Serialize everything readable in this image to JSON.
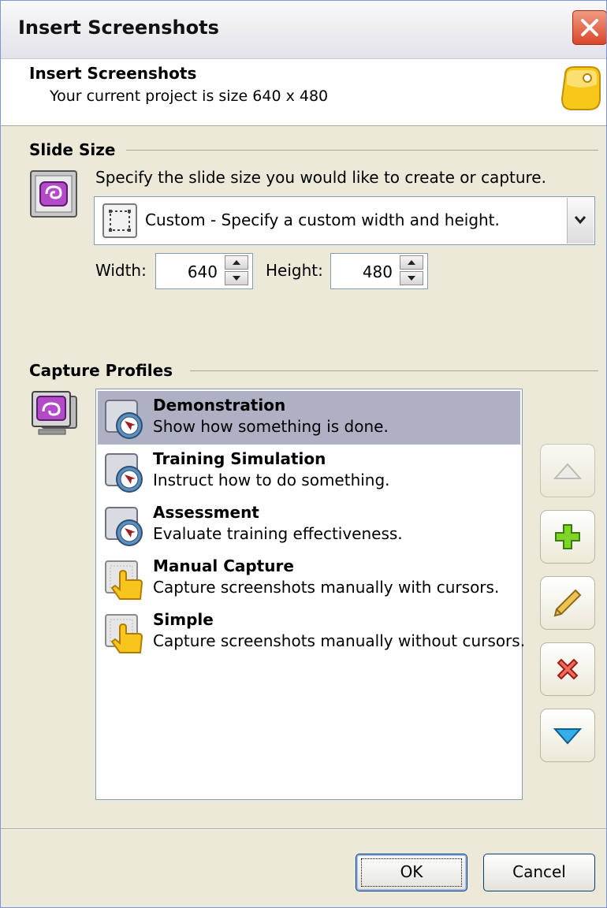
{
  "window": {
    "title": "Insert Screenshots",
    "close_icon": "close-x-icon"
  },
  "header": {
    "title": "Insert Screenshots",
    "subtitle": "Your current project is size 640 x 480",
    "icon": "yellow-tag-icon"
  },
  "slide_size": {
    "section_label": "Slide Size",
    "icon": "monitor-slide-icon",
    "instruction": "Specify the slide size you would like to create or capture.",
    "combo_value": "Custom - Specify a custom width and height.",
    "combo_icon": "custom-size-icon",
    "width_label": "Width:",
    "width_value": "640",
    "height_label": "Height:",
    "height_value": "480"
  },
  "capture_profiles": {
    "section_label": "Capture Profiles",
    "icon": "capture-monitor-icon",
    "items": [
      {
        "title": "Demonstration",
        "description": "Show how something is done.",
        "icon": "clock-cursor-icon",
        "selected": true
      },
      {
        "title": "Training Simulation",
        "description": "Instruct how to do something.",
        "icon": "clock-cursor-icon",
        "selected": false
      },
      {
        "title": "Assessment",
        "description": "Evaluate training effectiveness.",
        "icon": "clock-cursor-icon",
        "selected": false
      },
      {
        "title": "Manual Capture",
        "description": "Capture screenshots manually with cursors.",
        "icon": "hand-pointer-icon",
        "selected": false
      },
      {
        "title": "Simple",
        "description": "Capture screenshots manually without cursors.",
        "icon": "hand-pointer-icon",
        "selected": false
      }
    ],
    "side_buttons": [
      "move-up-icon",
      "add-icon",
      "edit-pencil-icon",
      "delete-x-icon",
      "move-down-icon"
    ]
  },
  "buttons": {
    "ok": "OK",
    "cancel": "Cancel"
  },
  "colors": {
    "selection": "#aeb0c4",
    "dialog_bg": "#ece9d8",
    "accent_add": "#6ccb1f",
    "accent_delete": "#e0332a",
    "accent_down": "#2a9fe0"
  }
}
